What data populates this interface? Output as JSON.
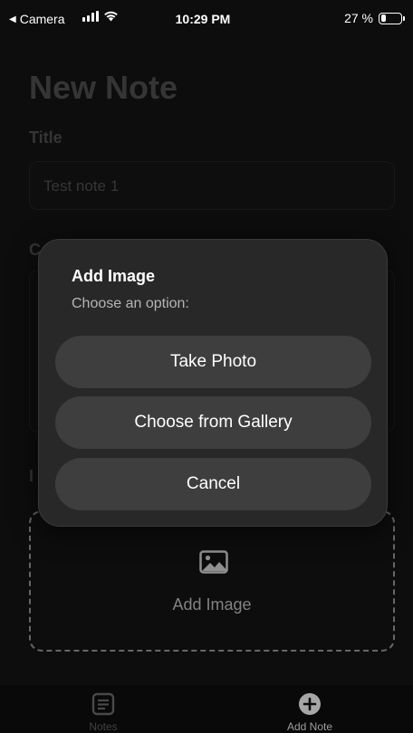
{
  "status_bar": {
    "back_app": "Camera",
    "time": "10:29 PM",
    "battery": "27 %",
    "battery_level_percent": 27
  },
  "page": {
    "title": "New Note",
    "title_label": "Title",
    "title_value": "Test note 1",
    "content_label": "Co",
    "image_label": "I",
    "dropzone_label": "Add Image",
    "dropzone_icon": "image-icon"
  },
  "dialog": {
    "title": "Add Image",
    "subtitle": "Choose an option:",
    "buttons": [
      "Take Photo",
      "Choose from Gallery",
      "Cancel"
    ]
  },
  "tabbar": {
    "tabs": [
      {
        "label": "Notes",
        "icon": "notes-icon"
      },
      {
        "label": "Add Note",
        "icon": "plus-circle-icon"
      }
    ]
  },
  "colors": {
    "background": "#131313",
    "dialog": "#282828",
    "dialog_button": "#3e3e3e",
    "muted_text": "#4a4a4a"
  }
}
